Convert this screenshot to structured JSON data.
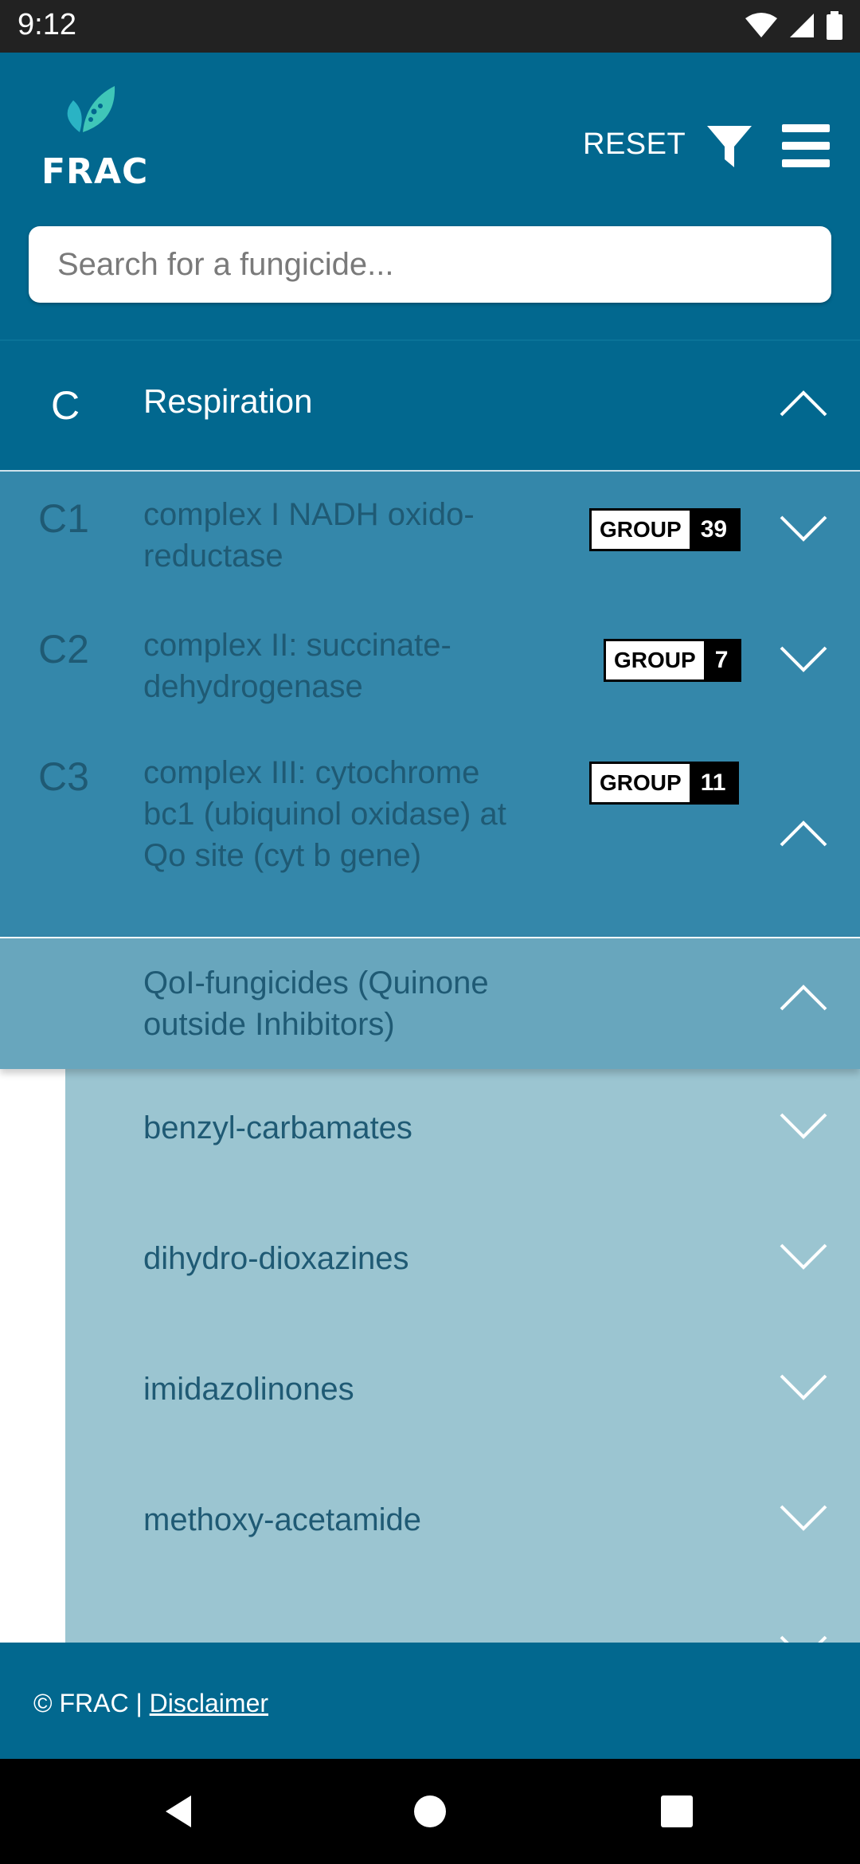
{
  "status_bar": {
    "time": "9:12"
  },
  "header": {
    "logo_text": "FRAC",
    "reset_label": "RESET",
    "search_placeholder": "Search for a fungicide..."
  },
  "category": {
    "code": "C",
    "label": "Respiration",
    "expanded": true
  },
  "subgroups": [
    {
      "code": "C1",
      "label": "complex I NADH oxido-reductase",
      "group_label": "GROUP",
      "group_number": "39",
      "expanded": false
    },
    {
      "code": "C2",
      "label": "complex II: succinate-dehydrogenase",
      "group_label": "GROUP",
      "group_number": "7",
      "expanded": false
    },
    {
      "code": "C3",
      "label": "complex III: cytochrome bc1 (ubiquinol oxidase) at Qo site (cyt b gene)",
      "group_label": "GROUP",
      "group_number": "11",
      "expanded": true
    }
  ],
  "qoi": {
    "label": "QoI-fungicides (Quinone outside Inhibitors)",
    "expanded": true
  },
  "chemical_groups": [
    {
      "label": "benzyl-carbamates"
    },
    {
      "label": "dihydro-dioxazines"
    },
    {
      "label": "imidazolinones"
    },
    {
      "label": "methoxy-acetamide"
    }
  ],
  "footer": {
    "copyright": "© FRAC | ",
    "disclaimer_link": "Disclaimer"
  },
  "colors": {
    "header_bg": "#02688f",
    "subgroup_bg": "#3487aa",
    "qoi_bg": "#68a6bd",
    "chem_bg": "#9bc5d1",
    "text_dark": "#1f5a74"
  },
  "icons": [
    "wifi-icon",
    "signal-icon",
    "battery-icon",
    "leaf-logo-icon",
    "filter-icon",
    "menu-icon",
    "chevron-up-icon",
    "chevron-down-icon",
    "back-icon",
    "home-icon",
    "recents-icon"
  ]
}
